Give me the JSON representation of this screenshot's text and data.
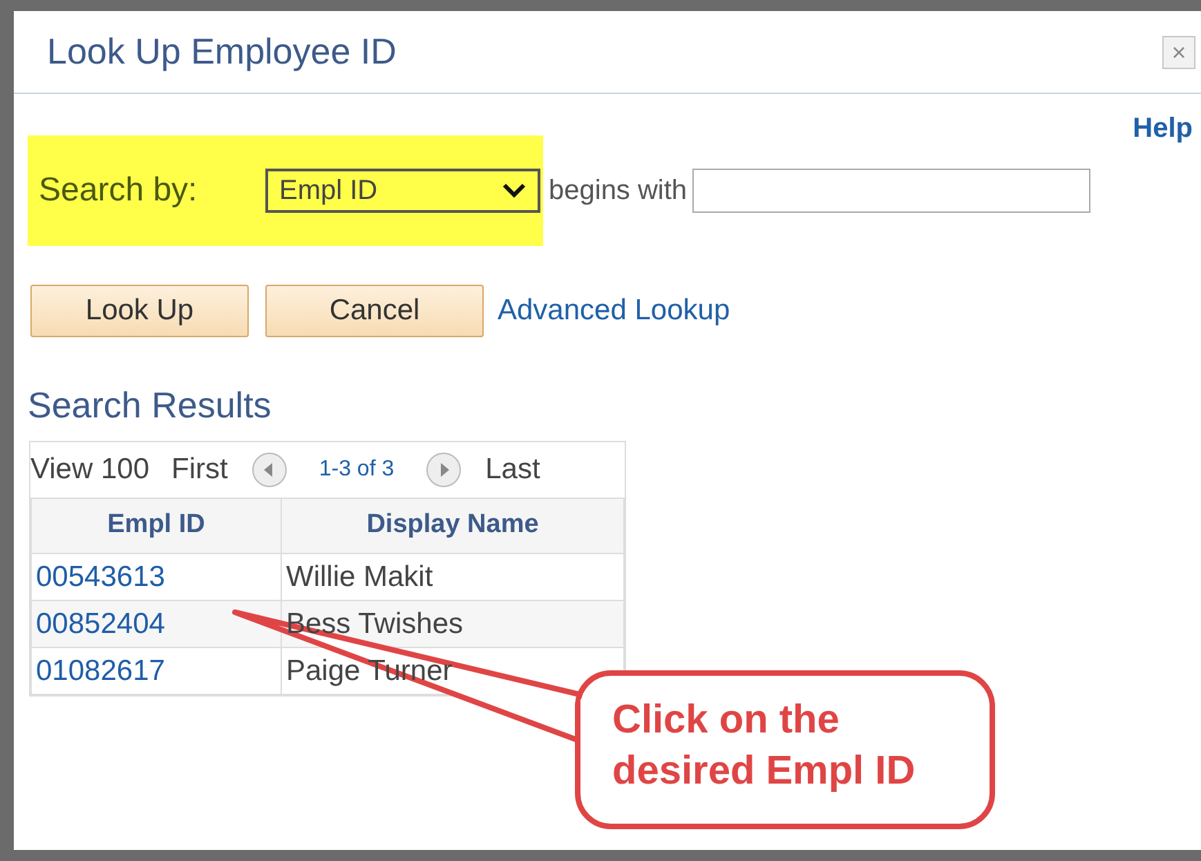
{
  "window": {
    "title": "Look Up Employee ID",
    "close": "×"
  },
  "help": "Help",
  "search": {
    "label": "Search by:",
    "field": "Empl ID",
    "operator": "begins with"
  },
  "buttons": [
    "Look Up",
    "Cancel"
  ],
  "advanced_link": "Advanced Lookup",
  "results": {
    "title": "Search Results",
    "view": "View 100",
    "first": "First",
    "range": "1-3 of 3",
    "last": "Last",
    "columns": [
      "Empl ID",
      "Display Name"
    ],
    "rows": [
      {
        "id": "00543613",
        "name": "Willie Makit"
      },
      {
        "id": "00852404",
        "name": "Bess Twishes"
      },
      {
        "id": "01082617",
        "name": "Paige Turner"
      }
    ]
  },
  "callout": {
    "lines": [
      "Click on the",
      "desired Empl ID"
    ]
  }
}
